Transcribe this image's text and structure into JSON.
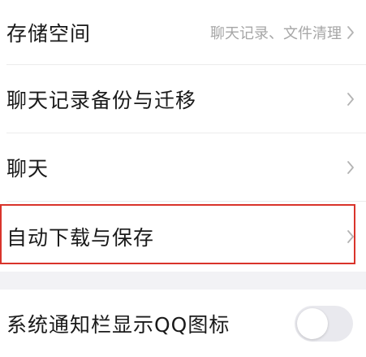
{
  "settings": {
    "rows": [
      {
        "label": "存储空间",
        "subtext": "聊天记录、文件清理"
      },
      {
        "label": "聊天记录备份与迁移"
      },
      {
        "label": "聊天"
      },
      {
        "label": "自动下载与保存"
      }
    ],
    "toggle_row": {
      "label": "系统通知栏显示QQ图标",
      "toggle_on": false
    }
  },
  "colors": {
    "highlight": "#d9342b",
    "section_gap": "#f2f2f5",
    "subtext": "#a6a6a6"
  },
  "icons": {
    "chevron": "chevron-right-icon"
  }
}
